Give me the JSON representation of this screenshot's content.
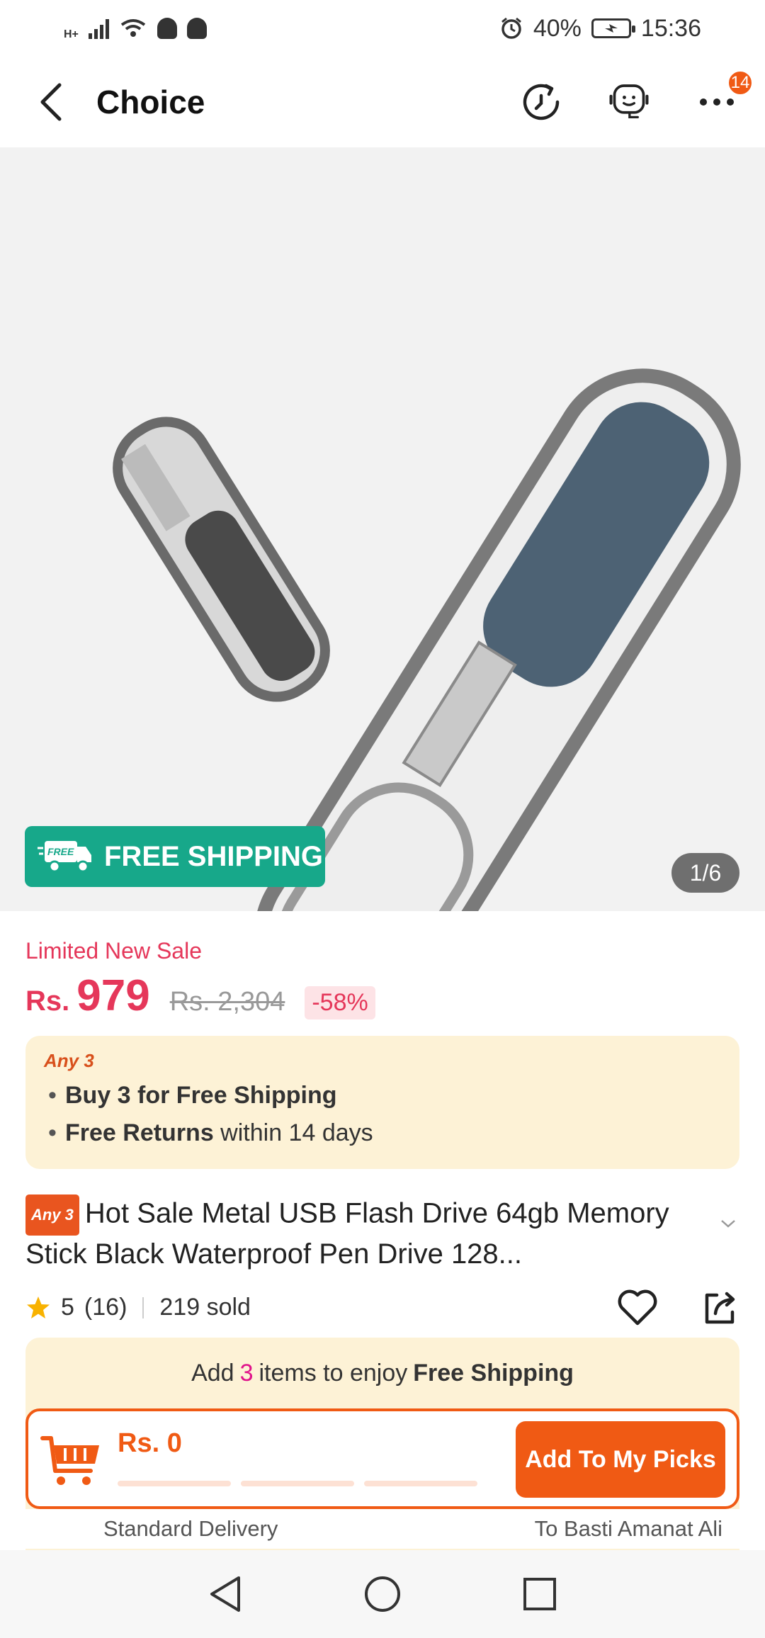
{
  "status_bar": {
    "network": "H+",
    "battery_percent": "40%",
    "time": "15:36"
  },
  "header": {
    "back_icon": "chevron-left-icon",
    "title": "Choice",
    "notification_count": "14"
  },
  "gallery": {
    "free_shipping_label": "FREE SHIPPING",
    "free_truck_text": "FREE",
    "page_indicator": "1/6"
  },
  "price": {
    "sale_label": "Limited New Sale",
    "currency": "Rs.",
    "current": "979",
    "original": "Rs. 2,304",
    "discount": "-58%"
  },
  "promo": {
    "tag": "Any 3",
    "line1_bold": "Buy 3 for  Free Shipping",
    "line2_bold": "Free Returns",
    "line2_rest": " within 14 days"
  },
  "product": {
    "badge": "Any 3",
    "title": "Hot Sale Metal USB Flash Drive 64gb Memory Stick Black Waterproof Pen Drive 128..."
  },
  "rating": {
    "score": "5",
    "count": "(16)",
    "sold": "219 sold"
  },
  "shipping_bar": {
    "prefix": "Add",
    "items_count": "3",
    "middle": "items to enjoy",
    "bold": "Free Shipping",
    "cart_total": "Rs. 0",
    "add_button": "Add To My Picks"
  },
  "delivery": {
    "left": "Standard Delivery",
    "right": "To Basti Amanat Ali"
  },
  "colors": {
    "accent": "#f05a14",
    "price_red": "#e5375a",
    "free_green": "#17a88a",
    "promo_bg": "#fdf2d6"
  }
}
